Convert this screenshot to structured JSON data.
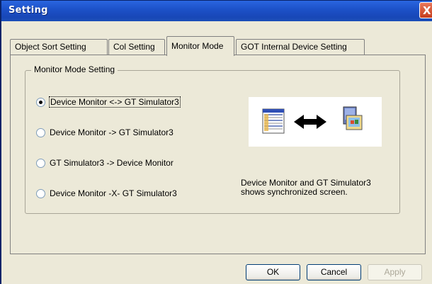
{
  "window": {
    "title": "Setting",
    "close_glyph": "X"
  },
  "tabs": [
    {
      "label": "Object Sort Setting",
      "active": false
    },
    {
      "label": "Col Setting",
      "active": false
    },
    {
      "label": "Monitor Mode",
      "active": true
    },
    {
      "label": "GOT Internal Device Setting",
      "active": false
    }
  ],
  "group": {
    "title": "Monitor Mode Setting"
  },
  "options": [
    {
      "label": "Device Monitor <-> GT Simulator3",
      "checked": true
    },
    {
      "label": "Device Monitor -> GT Simulator3",
      "checked": false
    },
    {
      "label": "GT Simulator3 -> Device Monitor",
      "checked": false
    },
    {
      "label": "Device Monitor -X- GT Simulator3",
      "checked": false
    }
  ],
  "preview": {
    "left_icon": "device-monitor-icon",
    "arrow_icon": "double-arrow-icon",
    "right_icon": "gt-simulator-icon"
  },
  "description": {
    "line1": "Device Monitor and GT Simulator3",
    "line2": "shows synchronized screen."
  },
  "buttons": {
    "ok": "OK",
    "cancel": "Cancel",
    "apply": "Apply"
  }
}
